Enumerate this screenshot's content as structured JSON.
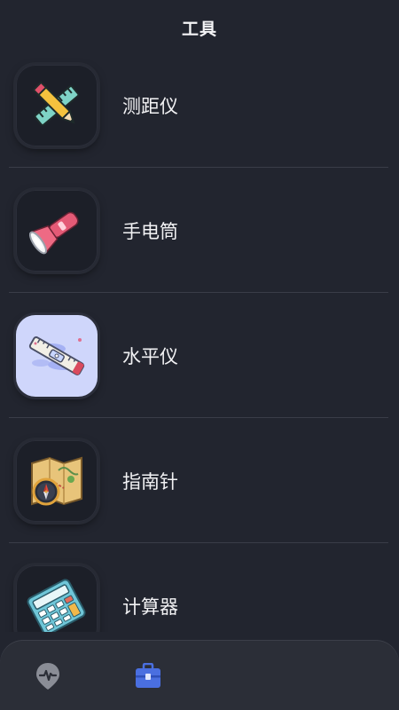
{
  "header": {
    "title": "工具"
  },
  "tools": [
    {
      "label": "测距仪",
      "icon": "ruler-pencil-icon"
    },
    {
      "label": "手电筒",
      "icon": "flashlight-icon"
    },
    {
      "label": "水平仪",
      "icon": "spirit-level-icon"
    },
    {
      "label": "指南针",
      "icon": "compass-icon"
    },
    {
      "label": "计算器",
      "icon": "calculator-icon"
    }
  ],
  "tabbar": {
    "tabs": [
      {
        "icon": "location-pulse-icon",
        "active": false
      },
      {
        "icon": "toolbox-icon",
        "active": true
      }
    ]
  },
  "colors": {
    "background": "#22252f",
    "tab_active": "#4a6fe0",
    "tab_inactive": "#8a8d96"
  }
}
